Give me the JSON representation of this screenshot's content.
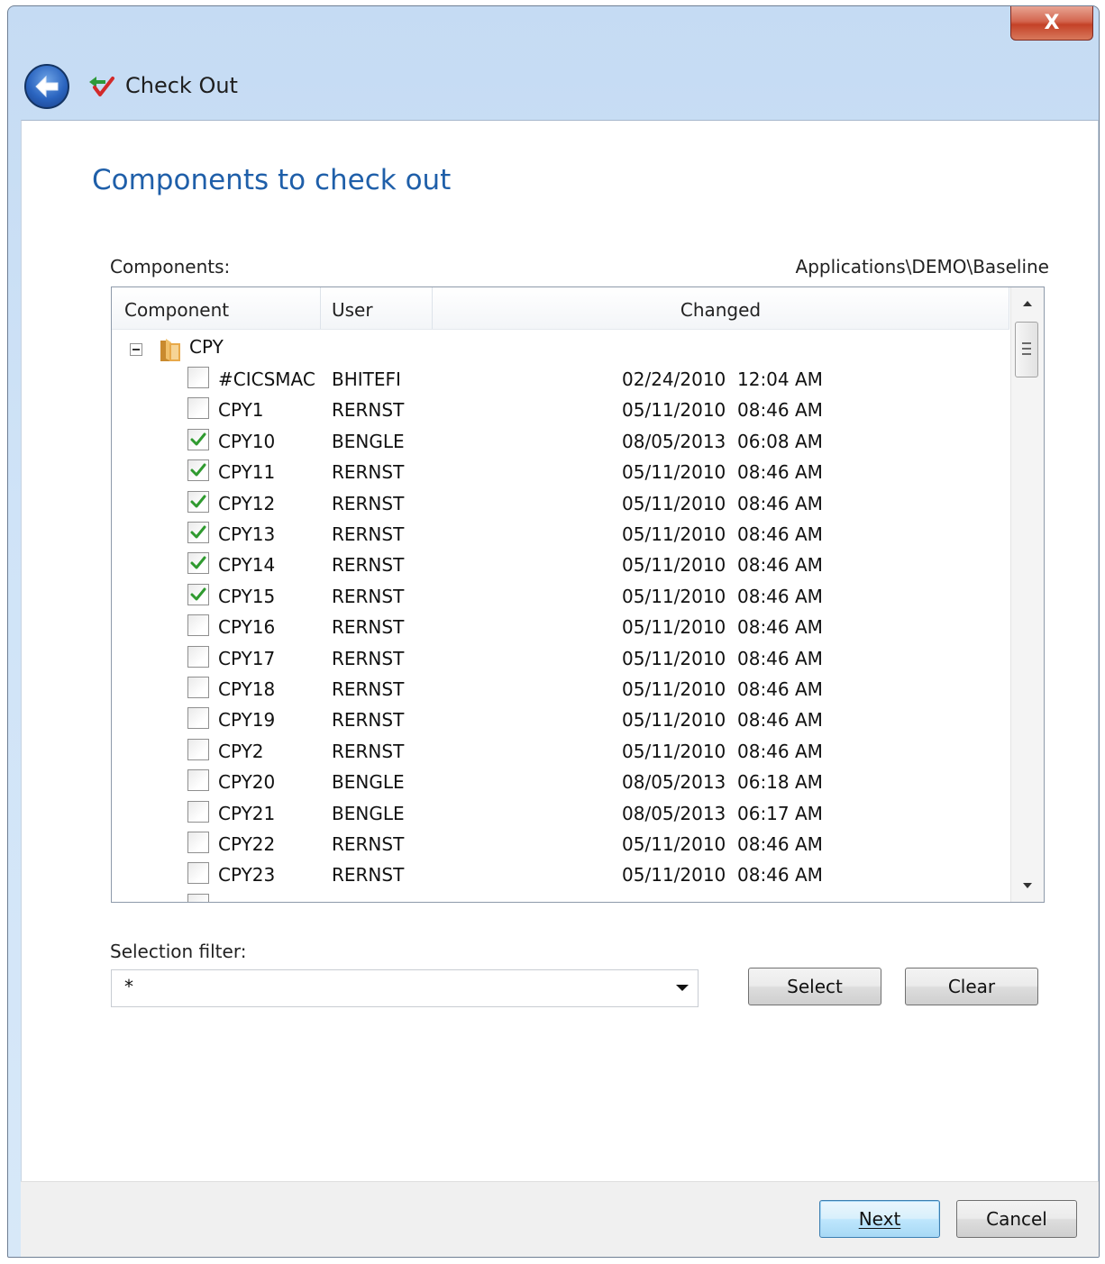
{
  "window": {
    "close_label": "X",
    "title": "Check Out"
  },
  "page": {
    "heading": "Components to check out",
    "components_label": "Components:",
    "path": "Applications\\DEMO\\Baseline"
  },
  "grid": {
    "columns": [
      "Component",
      "User",
      "Changed"
    ],
    "group": "CPY",
    "rows": [
      {
        "name": "#CICSMAC",
        "user": "BHITEFI",
        "changed": "02/24/2010  12:04 AM",
        "checked": false
      },
      {
        "name": "CPY1",
        "user": "RERNST",
        "changed": "05/11/2010  08:46 AM",
        "checked": false
      },
      {
        "name": "CPY10",
        "user": "BENGLE",
        "changed": "08/05/2013  06:08 AM",
        "checked": true
      },
      {
        "name": "CPY11",
        "user": "RERNST",
        "changed": "05/11/2010  08:46 AM",
        "checked": true
      },
      {
        "name": "CPY12",
        "user": "RERNST",
        "changed": "05/11/2010  08:46 AM",
        "checked": true
      },
      {
        "name": "CPY13",
        "user": "RERNST",
        "changed": "05/11/2010  08:46 AM",
        "checked": true
      },
      {
        "name": "CPY14",
        "user": "RERNST",
        "changed": "05/11/2010  08:46 AM",
        "checked": true
      },
      {
        "name": "CPY15",
        "user": "RERNST",
        "changed": "05/11/2010  08:46 AM",
        "checked": true
      },
      {
        "name": "CPY16",
        "user": "RERNST",
        "changed": "05/11/2010  08:46 AM",
        "checked": false
      },
      {
        "name": "CPY17",
        "user": "RERNST",
        "changed": "05/11/2010  08:46 AM",
        "checked": false
      },
      {
        "name": "CPY18",
        "user": "RERNST",
        "changed": "05/11/2010  08:46 AM",
        "checked": false
      },
      {
        "name": "CPY19",
        "user": "RERNST",
        "changed": "05/11/2010  08:46 AM",
        "checked": false
      },
      {
        "name": "CPY2",
        "user": "RERNST",
        "changed": "05/11/2010  08:46 AM",
        "checked": false
      },
      {
        "name": "CPY20",
        "user": "BENGLE",
        "changed": "08/05/2013  06:18 AM",
        "checked": false
      },
      {
        "name": "CPY21",
        "user": "BENGLE",
        "changed": "08/05/2013  06:17 AM",
        "checked": false
      },
      {
        "name": "CPY22",
        "user": "RERNST",
        "changed": "05/11/2010  08:46 AM",
        "checked": false
      },
      {
        "name": "CPY23",
        "user": "RERNST",
        "changed": "05/11/2010  08:46 AM",
        "checked": false
      }
    ]
  },
  "filter": {
    "label": "Selection filter:",
    "value": "*"
  },
  "buttons": {
    "select": "Select",
    "clear": "Clear",
    "next": "Next",
    "cancel": "Cancel"
  },
  "colors": {
    "heading": "#1f5fa9",
    "checkmark": "#2f9a2f"
  }
}
